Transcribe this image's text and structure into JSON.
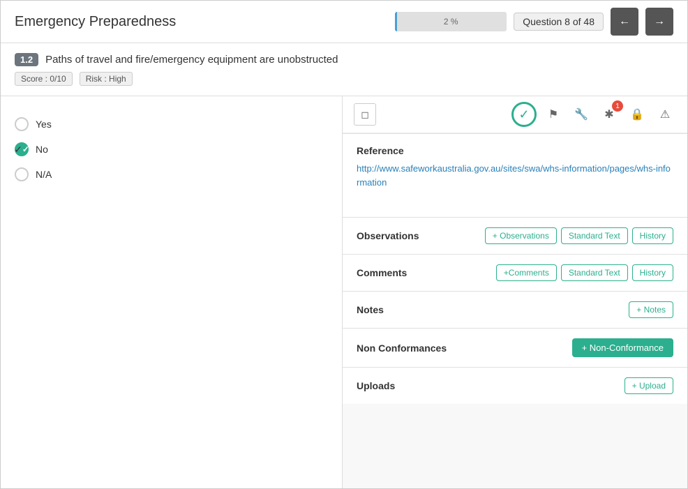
{
  "header": {
    "title": "Emergency Preparedness",
    "progress_percent": "2 %",
    "question_label": "Question 8 of 48"
  },
  "question": {
    "number": "1.2",
    "text": "Paths of travel and fire/emergency equipment are unobstructed",
    "score": "Score : 0/10",
    "risk": "Risk : High"
  },
  "answers": [
    {
      "label": "Yes",
      "checked": false
    },
    {
      "label": "No",
      "checked": true
    },
    {
      "label": "N/A",
      "checked": false
    }
  ],
  "reference": {
    "label": "Reference",
    "url": "http://www.safeworkaustralia.gov.au/sites/swa/whs-information/pages/whs-information"
  },
  "observations": {
    "label": "Observations",
    "btn_add": "+ Observations",
    "btn_standard": "Standard Text",
    "btn_history": "History"
  },
  "comments": {
    "label": "Comments",
    "btn_add": "+Comments",
    "btn_standard": "Standard Text",
    "btn_history": "History"
  },
  "notes": {
    "label": "Notes",
    "btn_add": "+ Notes"
  },
  "non_conformances": {
    "label": "Non Conformances",
    "btn_add": "+ Non-Conformance"
  },
  "uploads": {
    "label": "Uploads",
    "btn_add": "+ Upload"
  },
  "icons": {
    "check": "✓",
    "flag": "⚑",
    "wrench": "🔧",
    "asterisk": "✱",
    "lock": "🔒",
    "warning": "⚠",
    "collapse": "⊟",
    "prev_arrow": "←",
    "next_arrow": "→"
  },
  "notification_count": "1"
}
